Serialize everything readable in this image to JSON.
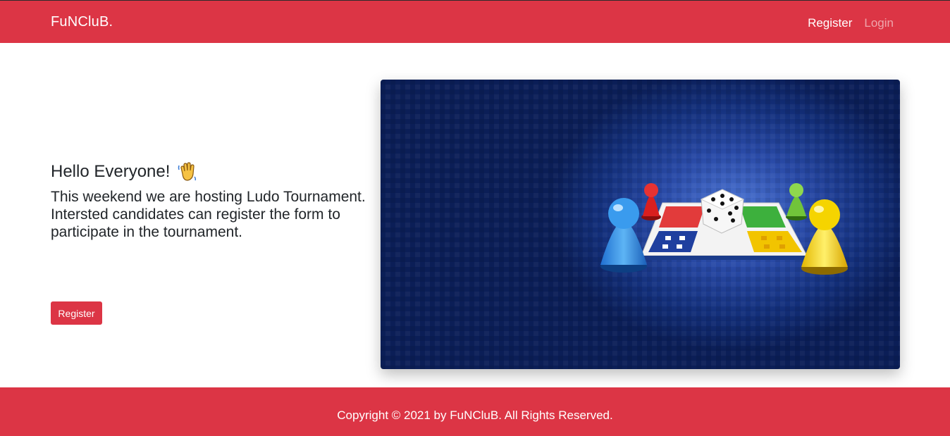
{
  "navbar": {
    "brand": "FuNCluB.",
    "links": [
      {
        "label": "Register"
      },
      {
        "label": "Login"
      }
    ],
    "color": "#dc3545"
  },
  "hero": {
    "greeting": "Hello Everyone!",
    "greeting_icon": "waving-hand-icon",
    "line1": "This weekend we are hosting Ludo Tournament.",
    "line2": "Intersted candidates can register the form to participate in the tournament.",
    "button_label": "Register",
    "image_icon": "ludo-board-illustration"
  },
  "footer": {
    "text": "Copyright © 2021 by FuNCluB. All Rights Reserved."
  }
}
